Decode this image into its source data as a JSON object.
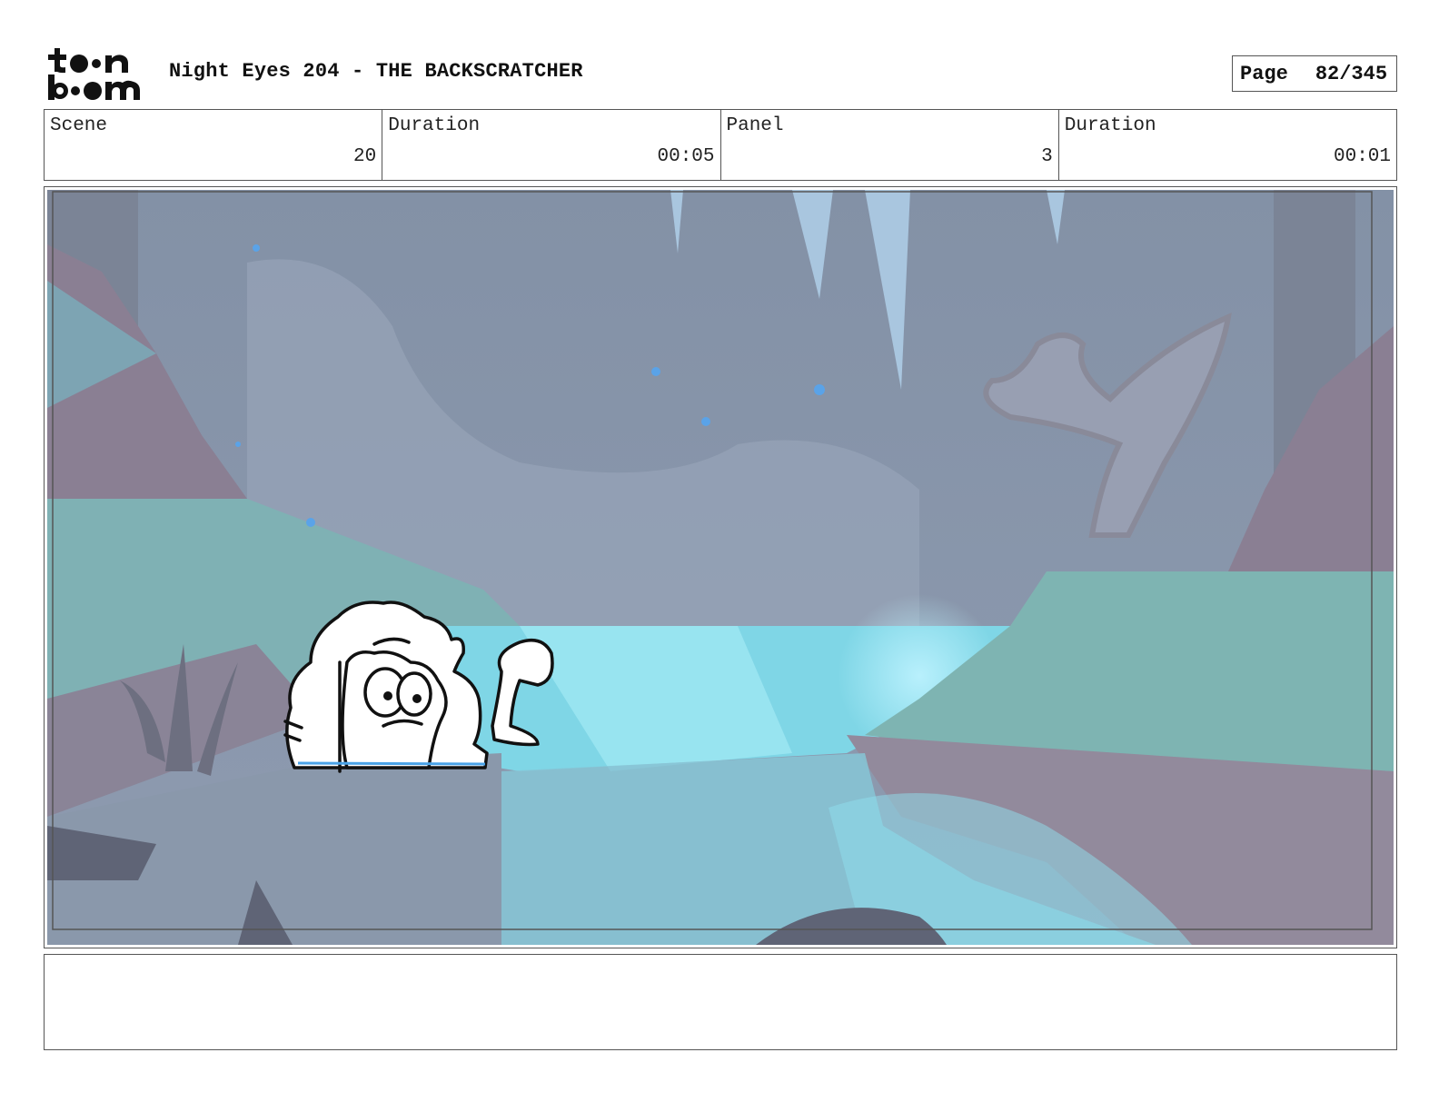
{
  "header": {
    "logo_text_top": "toon",
    "logo_text_bottom": "boom",
    "title": "Night Eyes 204 - THE BACKSCRATCHER",
    "page_label": "Page",
    "page_value": "82/345"
  },
  "info": {
    "scene_label": "Scene",
    "scene_value": "20",
    "scene_duration_label": "Duration",
    "scene_duration_value": "00:05",
    "panel_label": "Panel",
    "panel_value": "3",
    "panel_duration_label": "Duration",
    "panel_duration_value": "00:01"
  },
  "panel": {
    "image_icon": "storyboard-panel-image",
    "colors": {
      "background": "#8d9aae",
      "water": "#7fd6e6",
      "bank": "#7fb3b6",
      "rock": "#9a8e9c"
    }
  },
  "notes": {
    "text": ""
  }
}
